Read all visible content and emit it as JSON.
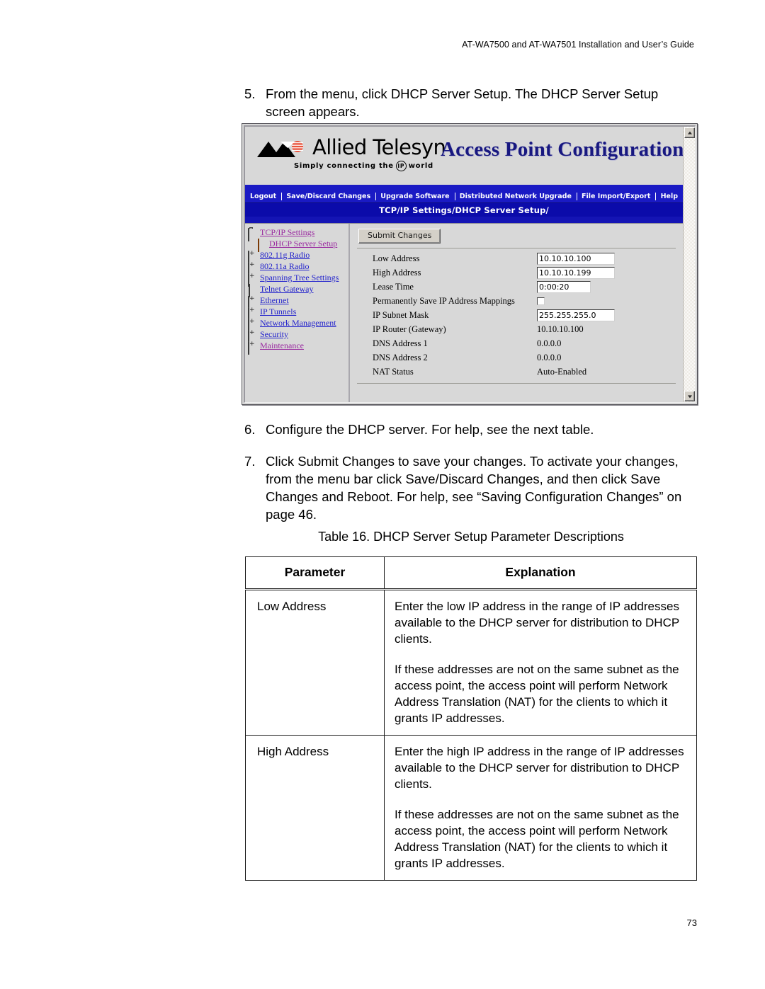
{
  "running_header": "AT-WA7500 and AT-WA7501 Installation and User’s Guide",
  "steps": [
    {
      "number": "5.",
      "text": "From the menu, click DHCP Server Setup. The DHCP Server Setup screen appears."
    },
    {
      "number": "6.",
      "text": "Configure the DHCP server. For help, see the next table."
    },
    {
      "number": "7.",
      "text": "Click Submit Changes to save your changes. To activate your changes, from the menu bar click Save/Discard Changes, and then click Save Changes and Reboot. For help, see “Saving Configuration Changes” on page 46."
    }
  ],
  "screenshot": {
    "logo": {
      "wordmark": "Allied Telesyn",
      "tagline_before": "Simply  connecting  the",
      "tagline_badge": "IP",
      "tagline_after": "world"
    },
    "banner_title": "Access Point Configuration",
    "menu": [
      "Logout",
      "Save/Discard Changes",
      "Upgrade Software",
      "Distributed Network Upgrade",
      "File Import/Export",
      "Help"
    ],
    "breadcrumb": "TCP/IP Settings/DHCP Server Setup/",
    "nav_items": [
      {
        "label": "TCP/IP Settings",
        "icon": "folder-open-icon",
        "state": "visited",
        "indent": false
      },
      {
        "label": "DHCP Server Setup",
        "icon": "document-orange-icon",
        "state": "visited",
        "indent": true
      },
      {
        "label": "802.11g Radio",
        "icon": "folder-closed-icon",
        "state": "link",
        "indent": false
      },
      {
        "label": "802.11a Radio",
        "icon": "folder-closed-icon",
        "state": "link",
        "indent": false
      },
      {
        "label": "Spanning Tree Settings",
        "icon": "folder-closed-icon",
        "state": "link",
        "indent": false
      },
      {
        "label": "Telnet Gateway",
        "icon": "document-icon",
        "state": "link",
        "indent": false
      },
      {
        "label": "Ethernet",
        "icon": "folder-closed-icon",
        "state": "link",
        "indent": false
      },
      {
        "label": "IP Tunnels",
        "icon": "folder-closed-icon",
        "state": "link",
        "indent": false
      },
      {
        "label": "Network Management",
        "icon": "folder-closed-icon",
        "state": "link",
        "indent": false
      },
      {
        "label": "Security",
        "icon": "folder-closed-icon",
        "state": "link",
        "indent": false
      },
      {
        "label": "Maintenance",
        "icon": "folder-closed-icon",
        "state": "visited",
        "indent": false
      }
    ],
    "submit_label": "Submit Changes",
    "fields": [
      {
        "label": "Low Address",
        "value": "10.10.10.100",
        "kind": "text-wide"
      },
      {
        "label": "High Address",
        "value": "10.10.10.199",
        "kind": "text-wide"
      },
      {
        "label": "Lease Time",
        "value": "0:00:20",
        "kind": "text-mid"
      },
      {
        "label": "Permanently Save IP Address Mappings",
        "value": "",
        "kind": "checkbox",
        "checked": false
      },
      {
        "label": "IP Subnet Mask",
        "value": "255.255.255.0",
        "kind": "text-wide"
      },
      {
        "label": "IP Router (Gateway)",
        "value": "10.10.10.100",
        "kind": "readonly"
      },
      {
        "label": "DNS Address 1",
        "value": "0.0.0.0",
        "kind": "readonly"
      },
      {
        "label": "DNS Address 2",
        "value": "0.0.0.0",
        "kind": "readonly"
      },
      {
        "label": "NAT Status",
        "value": "Auto-Enabled",
        "kind": "readonly"
      }
    ]
  },
  "table": {
    "caption": "Table 16. DHCP Server Setup Parameter Descriptions",
    "headers": [
      "Parameter",
      "Explanation"
    ],
    "rows": [
      {
        "parameter": "Low Address",
        "paragraphs": [
          "Enter the low IP address in the range of IP addresses available to the DHCP server for distribution to DHCP clients.",
          "If these addresses are not on the same subnet as the access point, the access point will perform Network Address Translation (NAT) for the clients to which it grants IP addresses."
        ]
      },
      {
        "parameter": "High Address",
        "paragraphs": [
          "Enter the high IP address in the range of IP addresses available to the DHCP server for distribution to DHCP clients.",
          "If these addresses are not on the same subnet as the access point, the access point will perform Network Address Translation (NAT) for the clients to which it grants IP addresses."
        ]
      }
    ]
  },
  "page_number": "73",
  "colors": {
    "menu_blue": "#1a1ac4",
    "path_blue": "#0b0baa",
    "title_navy": "#181880",
    "link": "#2222cc",
    "visited_link": "#9a2aa0",
    "logo_accent": "#e8553e",
    "doc_orange": "#f07a1e"
  }
}
